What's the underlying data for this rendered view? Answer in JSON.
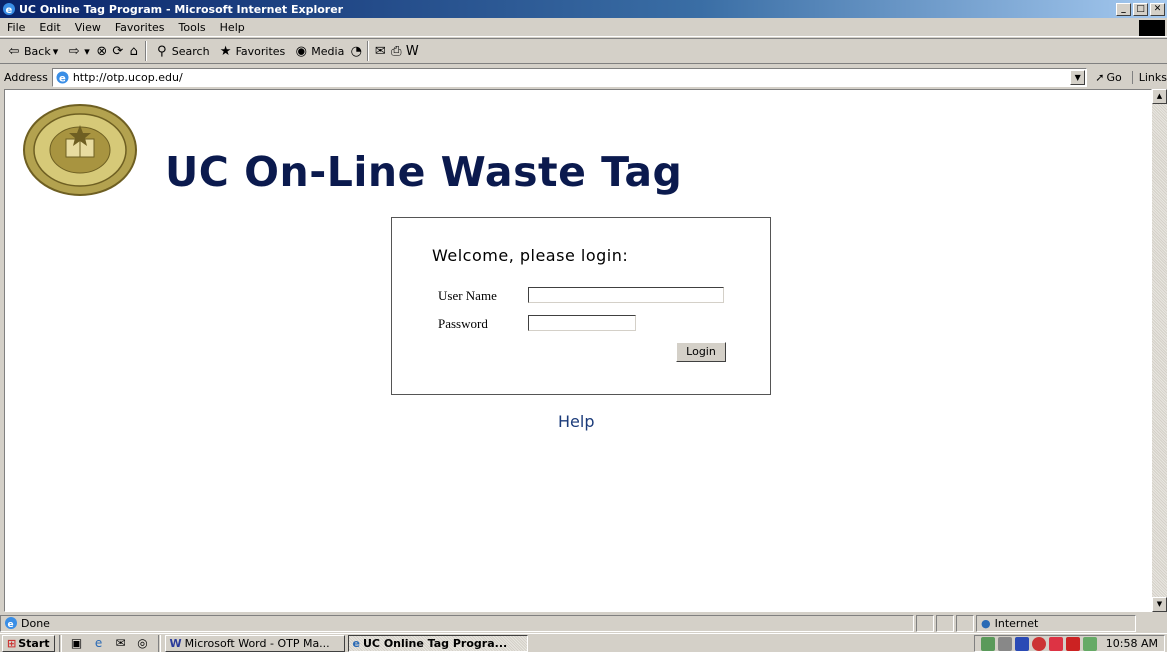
{
  "window": {
    "title": "UC Online Tag Program - Microsoft Internet Explorer",
    "controls": {
      "minimize": "_",
      "maximize": "□",
      "close": "✕"
    }
  },
  "menu": [
    "File",
    "Edit",
    "View",
    "Favorites",
    "Tools",
    "Help"
  ],
  "toolbar": {
    "back": "Back",
    "search": "Search",
    "favorites": "Favorites",
    "media": "Media"
  },
  "address": {
    "label": "Address",
    "url": "http://otp.ucop.edu/",
    "go": "Go",
    "links": "Links"
  },
  "page": {
    "heading": "UC On-Line Waste Tag",
    "welcome": "Welcome, please login:",
    "user_label": "User Name",
    "password_label": "Password",
    "user_value": "",
    "password_value": "",
    "login_button": "Login",
    "help_link": "Help"
  },
  "status": {
    "text": "Done",
    "zone": "Internet"
  },
  "taskbar": {
    "start": "Start",
    "tasks": [
      {
        "label": "Microsoft Word - OTP Ma...",
        "active": false
      },
      {
        "label": "UC Online Tag Progra...",
        "active": true
      }
    ],
    "clock": "10:58 AM"
  },
  "colors": {
    "heading": "#0b1a4e",
    "help_link": "#1b3b7a",
    "title_bar": "#0a246a",
    "seal_gold": "#9c8a3a"
  }
}
